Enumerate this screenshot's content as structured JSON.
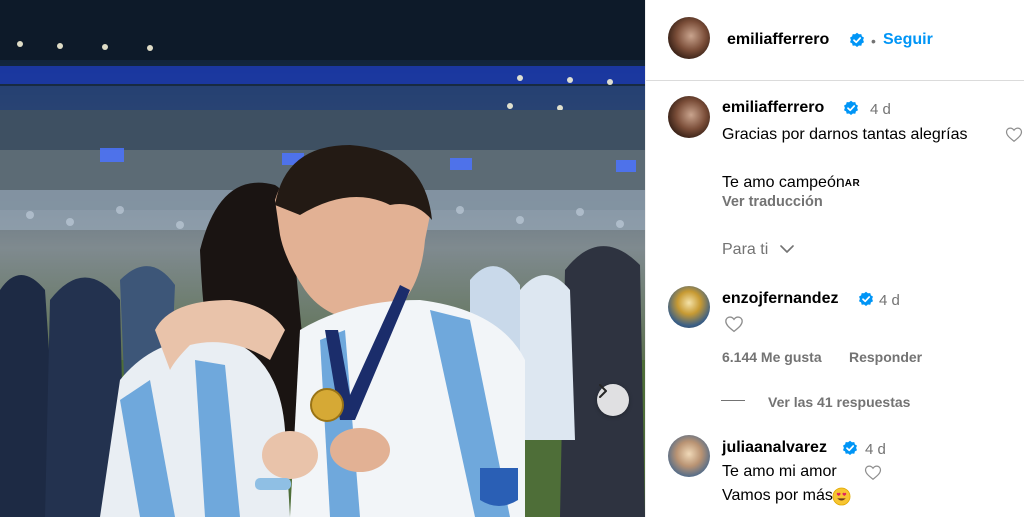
{
  "post": {
    "author": "emiliafferrero",
    "follow_label": "Seguir",
    "separator": "•"
  },
  "caption": {
    "author": "emiliafferrero",
    "time": "4 d",
    "line1": "Gracias por darnos tantas alegrías",
    "line2": "Te amo campeón",
    "flag_text": "AR",
    "translate_label": "Ver traducción"
  },
  "section_label": "Para ti",
  "comments": [
    {
      "author": "enzojfernandez",
      "time": "4 d",
      "likes": "6.144 Me gusta",
      "reply_label": "Responder",
      "view_replies": "Ver las 41 respuestas"
    },
    {
      "author": "juliaanalvarez",
      "time": "4 d",
      "line1": "Te amo mi amor",
      "line2": "Vamos por más"
    }
  ],
  "colors": {
    "link_blue": "#0095f6",
    "verified_blue": "#0095f6",
    "muted": "#737373",
    "jersey_blue": "#6fa8dc"
  },
  "icons": {
    "verified": "verified-badge-icon",
    "heart": "heart-outline-icon",
    "chevron": "chevron-down-icon",
    "next": "chevron-right-icon"
  }
}
